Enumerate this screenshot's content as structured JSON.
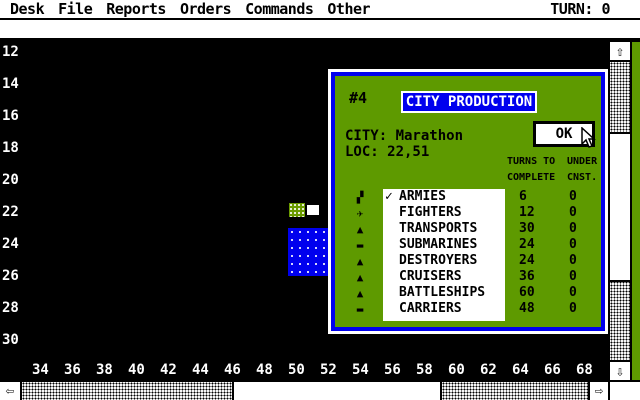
{
  "menu": [
    "Desk",
    "File",
    "Reports",
    "Orders",
    "Commands",
    "Other"
  ],
  "turn_label": "TURN: 0",
  "rows": [
    "12",
    "14",
    "16",
    "18",
    "20",
    "22",
    "24",
    "26",
    "28",
    "30"
  ],
  "cols": [
    "34",
    "36",
    "38",
    "40",
    "42",
    "44",
    "46",
    "48",
    "50",
    "52",
    "54",
    "56",
    "58",
    "60",
    "62",
    "64",
    "66",
    "68"
  ],
  "scroll": {
    "up": "⇧",
    "down": "⇩",
    "left": "⇦",
    "right": "⇨"
  },
  "dialog": {
    "city_number": "#4",
    "title": "CITY PRODUCTION",
    "city_line": "CITY: Marathon",
    "loc_line": "LOC:  22,51",
    "ok_label": "OK",
    "col_turns_1": "TURNS TO",
    "col_turns_2": "COMPLETE",
    "col_cnst_1": "UNDER",
    "col_cnst_2": "CNST.",
    "units": [
      {
        "check": "✓",
        "name": "ARMIES",
        "turns": "6",
        "cnst": "0",
        "icon": "army-icon",
        "glyph": "▞"
      },
      {
        "check": "",
        "name": "FIGHTERS",
        "turns": "12",
        "cnst": "0",
        "icon": "fighter-icon",
        "glyph": "✈"
      },
      {
        "check": "",
        "name": "TRANSPORTS",
        "turns": "30",
        "cnst": "0",
        "icon": "transport-icon",
        "glyph": "▲"
      },
      {
        "check": "",
        "name": "SUBMARINES",
        "turns": "24",
        "cnst": "0",
        "icon": "submarine-icon",
        "glyph": "▬"
      },
      {
        "check": "",
        "name": "DESTROYERS",
        "turns": "24",
        "cnst": "0",
        "icon": "destroyer-icon",
        "glyph": "▲"
      },
      {
        "check": "",
        "name": "CRUISERS",
        "turns": "36",
        "cnst": "0",
        "icon": "cruiser-icon",
        "glyph": "▲"
      },
      {
        "check": "",
        "name": "BATTLESHIPS",
        "turns": "60",
        "cnst": "0",
        "icon": "battleship-icon",
        "glyph": "▲"
      },
      {
        "check": "",
        "name": "CARRIERS",
        "turns": "48",
        "cnst": "0",
        "icon": "carrier-icon",
        "glyph": "▬"
      }
    ]
  },
  "colors": {
    "sea": "#0000ee",
    "land": "#5e9a00",
    "background": "#000000"
  }
}
